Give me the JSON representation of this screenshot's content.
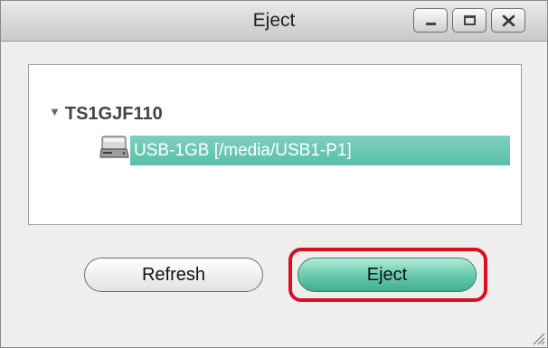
{
  "window": {
    "title": "Eject",
    "controls": {
      "minimize_icon": "minimize-icon",
      "maximize_icon": "maximize-icon",
      "close_icon": "close-icon"
    }
  },
  "tree": {
    "device": {
      "name": "TS1GJF110",
      "expanded": true,
      "icon": "triangle-down-icon"
    },
    "volume": {
      "label": "USB-1GB [/media/USB1-P1]",
      "selected": true,
      "icon": "drive-icon",
      "selection_color": "#66c6b1"
    }
  },
  "buttons": {
    "refresh_label": "Refresh",
    "eject_label": "Eject",
    "eject_color": "#5cc4a5"
  },
  "annotation": {
    "highlight_color": "#d80f1f",
    "target": "eject-button"
  }
}
